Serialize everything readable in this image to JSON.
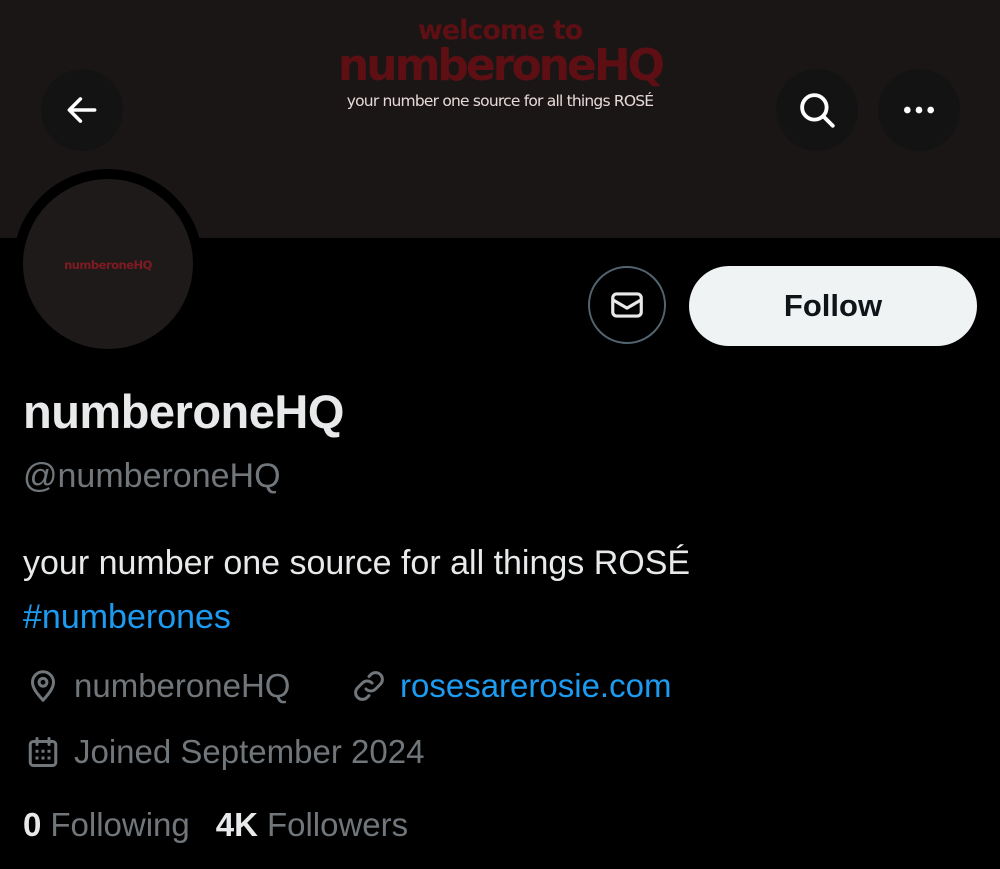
{
  "header": {
    "banner": {
      "welcome_text": "welcome to",
      "name_text": "numberoneHQ",
      "tagline": "your number one source for all things ROSÉ"
    },
    "back_icon": "arrow-left-icon",
    "search_icon": "search-icon",
    "more_icon": "more-horizontal-icon"
  },
  "profile": {
    "avatar_text": "numberoneHQ",
    "message_icon": "mail-icon",
    "follow_label": "Follow",
    "display_name": "numberoneHQ",
    "handle": "@numberoneHQ",
    "bio": "your number one source for all things ROSÉ",
    "hashtag": "#numberones",
    "location": "numberoneHQ",
    "website": "rosesarerosie.com",
    "joined": "Joined September 2024",
    "following_count": "0",
    "following_label": "Following",
    "followers_count": "4K",
    "followers_label": "Followers"
  },
  "colors": {
    "background": "#000000",
    "banner": "#1b1616",
    "banner_accent": "#5e0f13",
    "link": "#1d9bf0",
    "muted": "#71767b",
    "text": "#e7e9ea",
    "follow_bg": "#eff3f4"
  }
}
